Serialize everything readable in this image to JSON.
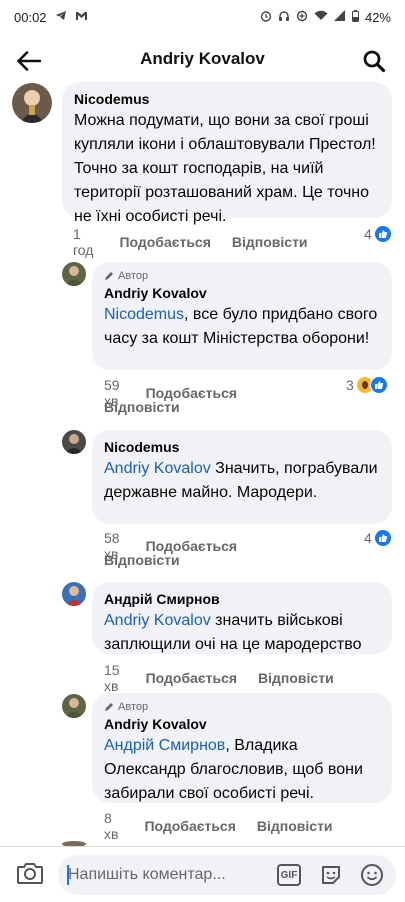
{
  "status_bar": {
    "time": "00:02",
    "battery": "42%"
  },
  "header": {
    "title": "Andriy Kovalov"
  },
  "comments": [
    {
      "name": "Nicodemus",
      "text": "Можна подумати, що вони за свої гроші купляли ікони і облаштовували Престол! Точно за кошт господарів, на чиїй території розташований храм. Це точно не їхні особисті речі.",
      "time": "1 год",
      "like": "Подобається",
      "reply": "Відповісти",
      "reactions": "4"
    },
    {
      "author_tag": "Автор",
      "name": "Andriy Kovalov",
      "mention": "Nicodemus",
      "text": ", все було придбано свого часу за кошт Міністерства оборони!",
      "time": "59 хв",
      "like": "Подобається",
      "reply": "Відповісти",
      "reactions": "3"
    },
    {
      "name": "Nicodemus",
      "mention": "Andriy Kovalov",
      "text": " Значить, пограбували державне майно. Мародери.",
      "time": "58 хв",
      "like": "Подобається",
      "reply": "Відповісти",
      "reactions": "4"
    },
    {
      "name": "Андрій Смирнов",
      "mention": "Andriy Kovalov",
      "text": " значить військові заплющили очі на це мародерство",
      "time": "15 хв",
      "like": "Подобається",
      "reply": "Відповісти"
    },
    {
      "author_tag": "Автор",
      "name": "Andriy Kovalov",
      "mention": "Андрій Смирнов",
      "text": ", Владика Олександр благословив, щоб вони забирали свої особисті речі.",
      "time": "8 хв",
      "like": "Подобається",
      "reply": "Відповісти"
    }
  ],
  "composer": {
    "placeholder": "Напишіть коментар...",
    "gif_label": "GIF"
  },
  "colors": {
    "bubble": "#f0f2f5",
    "mention": "#1b5fb5",
    "like_blue": "#1877f2",
    "meta_gray": "#65676b"
  }
}
